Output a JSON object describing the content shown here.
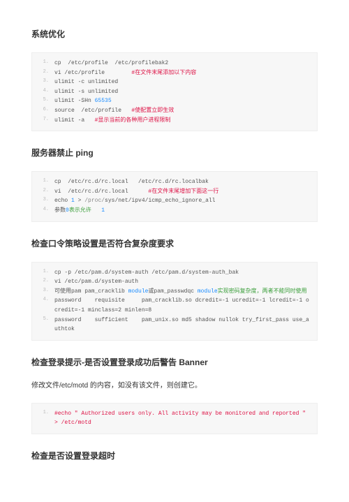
{
  "sections": [
    {
      "title": "系统优化",
      "blocks": [
        {
          "type": "code",
          "lines": [
            {
              "n": "1.",
              "parts": [
                {
                  "t": "cp  /etc/profile  /etc/profilebak2"
                }
              ]
            },
            {
              "n": "2.",
              "parts": [
                {
                  "t": "vi /etc/profile        "
                },
                {
                  "t": "#在文件末尾添加以下内容",
                  "c": "red"
                }
              ]
            },
            {
              "n": "3.",
              "parts": [
                {
                  "t": "ulimit -c unlimited"
                }
              ]
            },
            {
              "n": "4.",
              "parts": [
                {
                  "t": "ulimit -s unlimited"
                }
              ]
            },
            {
              "n": "5.",
              "parts": [
                {
                  "t": "ulimit -SHn "
                },
                {
                  "t": "65535",
                  "c": "num"
                }
              ]
            },
            {
              "n": "6.",
              "parts": [
                {
                  "t": "source  /etc/profile   "
                },
                {
                  "t": "#使配置立即生效",
                  "c": "red"
                }
              ]
            },
            {
              "n": "7.",
              "parts": [
                {
                  "t": "ulimit -a   "
                },
                {
                  "t": "#显示当前的各种用户进程限制",
                  "c": "red"
                }
              ]
            }
          ]
        }
      ]
    },
    {
      "title": "服务器禁止 ping",
      "blocks": [
        {
          "type": "code",
          "lines": [
            {
              "n": "1.",
              "parts": [
                {
                  "t": "cp  /etc/rc.d/rc.local   /etc/rc.d/rc.localbak"
                }
              ]
            },
            {
              "n": "2.",
              "parts": [
                {
                  "t": "vi  /etc/rc.d/rc.local      "
                },
                {
                  "t": "#在文件末尾增加下面这一行",
                  "c": "red"
                }
              ]
            },
            {
              "n": "3.",
              "parts": [
                {
                  "t": "echo "
                },
                {
                  "t": "1",
                  "c": "num"
                },
                {
                  "t": " > "
                },
                {
                  "t": "/proc/",
                  "c": "path"
                },
                {
                  "t": "sys/net/ipv4/icmp_echo_ignore_all"
                }
              ]
            },
            {
              "n": "4.",
              "parts": [
                {
                  "t": "参数"
                },
                {
                  "t": "0",
                  "c": "num"
                },
                {
                  "t": "表示允许",
                  "c": "green"
                },
                {
                  "t": "   1",
                  "c": "num"
                }
              ]
            }
          ]
        }
      ]
    },
    {
      "title": "检查口令策略设置是否符合复杂度要求",
      "blocks": [
        {
          "type": "code",
          "lines": [
            {
              "n": "1.",
              "parts": [
                {
                  "t": "cp -p /etc/pam.d/system-auth /etc/pam.d/system-auth_bak"
                }
              ]
            },
            {
              "n": "2.",
              "parts": [
                {
                  "t": "vi /etc/pam.d/system-auth"
                }
              ]
            },
            {
              "n": "3.",
              "parts": [
                {
                  "t": "可使用pam pam_cracklib "
                },
                {
                  "t": "module",
                  "c": "num"
                },
                {
                  "t": "或pam_passwdqc "
                },
                {
                  "t": "module",
                  "c": "num"
                },
                {
                  "t": "实现密码复杂度，两者不能同时使用",
                  "c": "green"
                }
              ]
            },
            {
              "n": "4.",
              "parts": [
                {
                  "t": "password    requisite     pam_cracklib.so dcredit=-1 ucredit=-1 lcredit=-1 ocredit=-1 minclass=2 minlen=8"
                }
              ]
            },
            {
              "n": "5.",
              "parts": [
                {
                  "t": "password    sufficient    pam_unix.so md5 shadow nullok try_first_pass use_authtok"
                }
              ]
            }
          ]
        }
      ]
    },
    {
      "title": "检查登录提示-是否设置登录成功后警告 Banner",
      "blocks": [
        {
          "type": "para",
          "text": "修改文件/etc/motd 的内容，如没有该文件，则创建它。"
        },
        {
          "type": "code",
          "lines": [
            {
              "n": "1.",
              "parts": [
                {
                  "t": "#echo \" Authorized users only. All activity may be monitored and reported \" > /etc/motd",
                  "c": "red"
                }
              ]
            }
          ]
        }
      ]
    },
    {
      "title": "检查是否设置登录超时",
      "blocks": []
    }
  ]
}
